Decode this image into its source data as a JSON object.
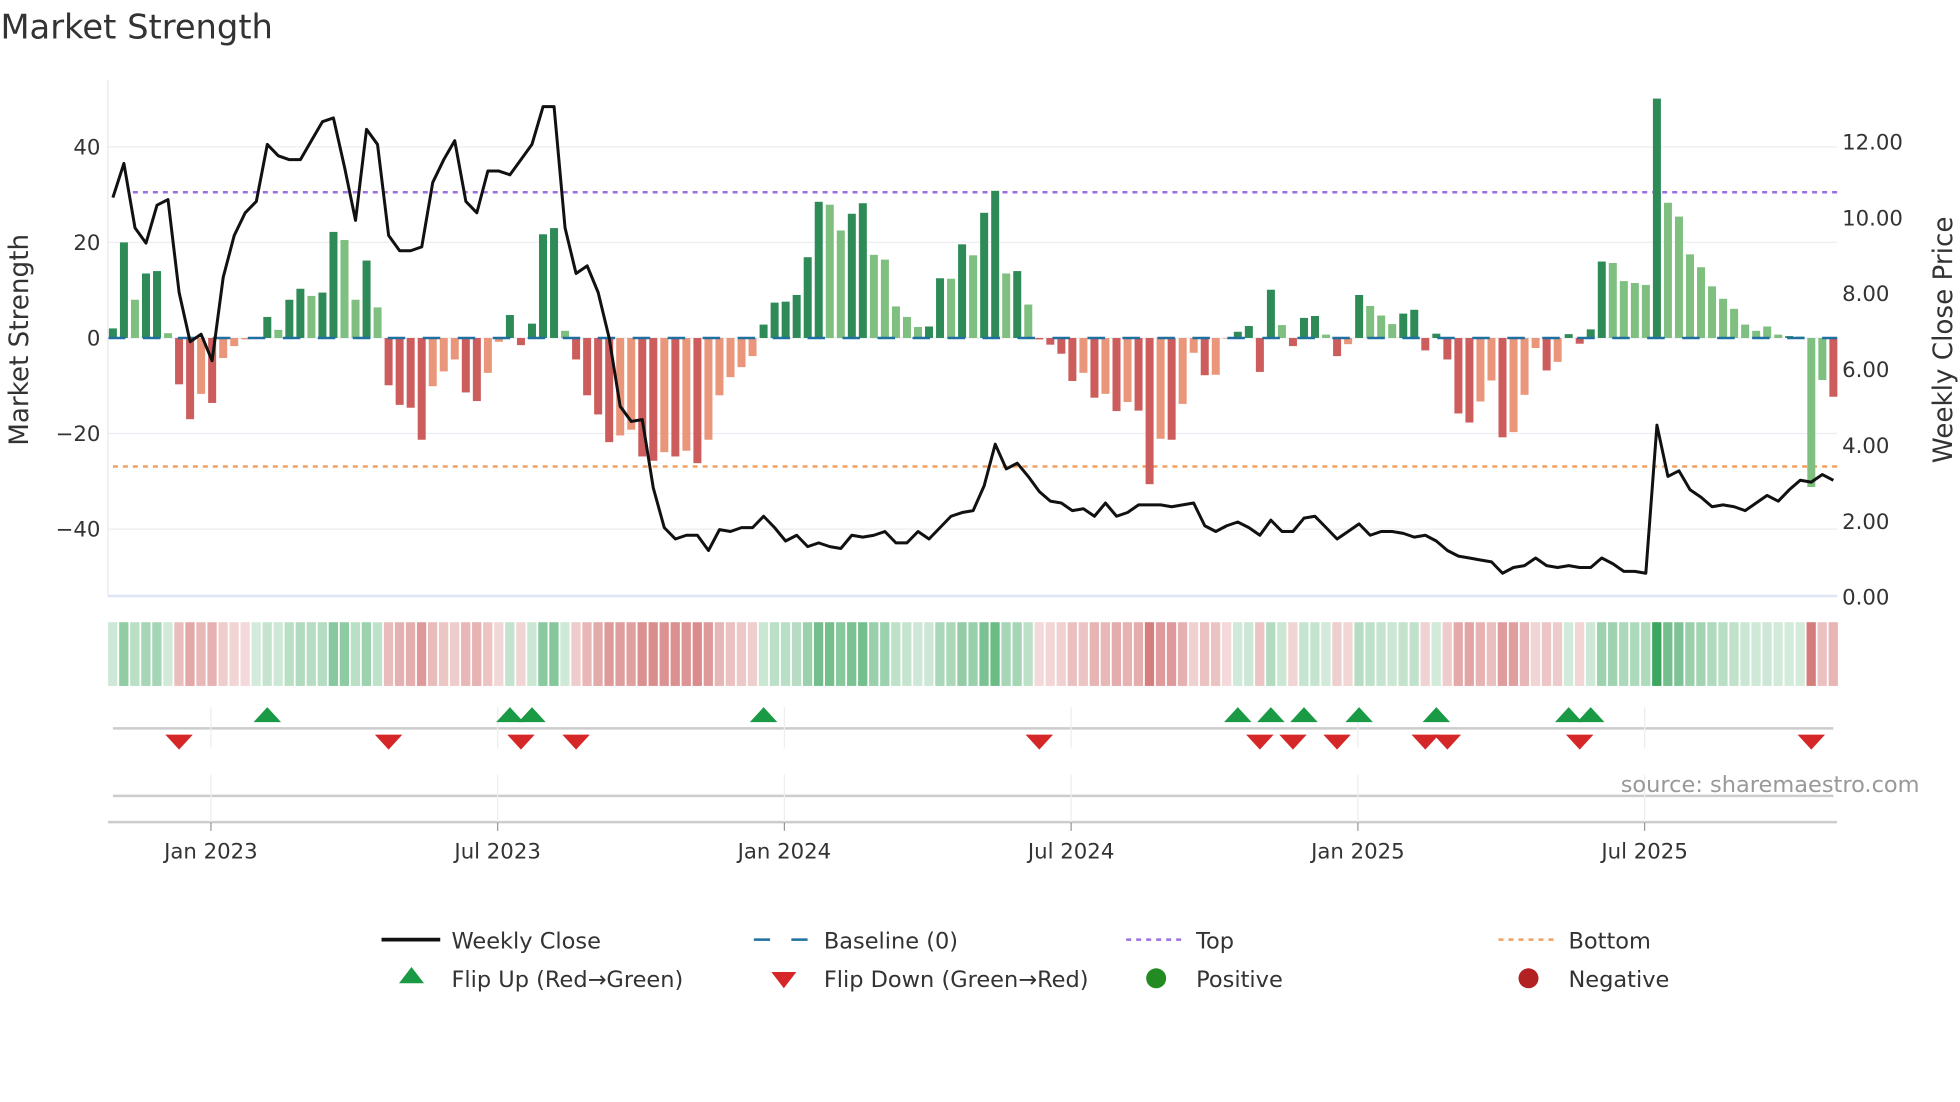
{
  "chart_data": {
    "type": "bar",
    "title": "Market Strength",
    "ylabel": "Market Strength",
    "y2label": "Weekly Close Price",
    "ylim": [
      -54,
      54
    ],
    "y2lim": [
      0,
      13.6
    ],
    "yticks": [
      "40",
      "20",
      "0",
      "−20",
      "−40"
    ],
    "ytick_values": [
      40,
      20,
      0,
      -20,
      -40
    ],
    "y2ticks": [
      "12.00",
      "10.00",
      "8.00",
      "6.00",
      "4.00",
      "2.00",
      "0.00"
    ],
    "y2tick_values": [
      12,
      10,
      8,
      6,
      4,
      2,
      0
    ],
    "xticks": [
      "Jan 2023",
      "Jul 2023",
      "Jan 2024",
      "Jul 2024",
      "Jan 2025",
      "Jul 2025"
    ],
    "xtick_week_index": [
      9,
      35,
      61,
      87,
      113,
      139
    ],
    "top_level": 30.5,
    "bottom_level": -26.9,
    "baseline": 0,
    "strength": [
      2,
      20,
      8,
      13.5,
      14,
      1,
      -9.7,
      -17,
      -11.7,
      -13.6,
      -4.2,
      -1.7,
      -0.3,
      0,
      4.4,
      1.7,
      8,
      10.3,
      8.8,
      9.5,
      22.2,
      20.5,
      8,
      16.2,
      6.4,
      -9.9,
      -14,
      -14.6,
      -21.3,
      -10.1,
      -7,
      -4.5,
      -11.4,
      -13.2,
      -7.3,
      -0.8,
      4.8,
      -1.5,
      3,
      21.7,
      23,
      1.5,
      -4.5,
      -12,
      -16,
      -21.8,
      -20.4,
      -19.2,
      -24.8,
      -25.7,
      -23.9,
      -24.8,
      -23.6,
      -26.2,
      -21.3,
      -12,
      -8.2,
      -6.1,
      -3.8,
      2.8,
      7.4,
      7.6,
      9,
      16.9,
      28.5,
      27.9,
      22.5,
      26,
      28.2,
      17.4,
      16.4,
      6.6,
      4.4,
      2.3,
      2.4,
      12.5,
      12.4,
      19.6,
      17.3,
      26.2,
      30.8,
      13.5,
      14,
      7,
      -0.3,
      -1.4,
      -3.3,
      -9,
      -7.3,
      -12.5,
      -11.7,
      -15.3,
      -13.4,
      -15.2,
      -30.6,
      -21.1,
      -21.3,
      -13.8,
      -3.1,
      -7.8,
      -7.7,
      -0.1,
      1.3,
      2.5,
      -7.1,
      10.1,
      2.7,
      -1.7,
      4.2,
      4.6,
      0.7,
      -3.8,
      -1.3,
      9,
      6.7,
      4.7,
      2.9,
      5.1,
      5.9,
      -2.6,
      0.9,
      -4.5,
      -15.8,
      -17.7,
      -13.3,
      -8.9,
      -20.8,
      -19.7,
      -11.9,
      -2.1,
      -6.8,
      -5,
      0.8,
      -1.2,
      1.8,
      16,
      15.7,
      11.9,
      11.5,
      11.1,
      50.1,
      28.3,
      25.4,
      17.5,
      14.8,
      10.8,
      8.2,
      6.1,
      2.8,
      1.5,
      2.4,
      0.7,
      0.4,
      0.3,
      -31.2,
      -8.8,
      -12.3
    ],
    "strength_shade": "GGgGGgRRrRrrrrGgGGgGGggGgRRRRrrrRRrrGRGGGgRRRRrrRRrRrRrrrrrGGGGGGggGGgggggGGgGgGGgGgRRRRrRrRrRRrRrrRrrGGRGgRGGgRrGgggGGRGRRRrrRrrrRrGRGGggggGgggggggggggGgggRrR",
    "weekly_close": [
      10.5,
      11.4,
      9.7,
      9.3,
      10.3,
      10.45,
      8.0,
      6.7,
      6.9,
      6.2,
      8.4,
      9.5,
      10.1,
      10.4,
      11.9,
      11.6,
      11.5,
      11.5,
      12.0,
      12.5,
      12.6,
      11.3,
      9.9,
      12.3,
      11.9,
      9.5,
      9.1,
      9.1,
      9.2,
      10.9,
      11.5,
      12.0,
      10.4,
      10.1,
      11.2,
      11.2,
      11.1,
      11.5,
      11.9,
      12.9,
      12.9,
      9.7,
      8.5,
      8.7,
      8.0,
      6.8,
      5.0,
      4.6,
      4.65,
      2.85,
      1.8,
      1.5,
      1.6,
      1.6,
      1.2,
      1.75,
      1.7,
      1.8,
      1.8,
      2.1,
      1.8,
      1.45,
      1.6,
      1.3,
      1.4,
      1.3,
      1.25,
      1.6,
      1.55,
      1.6,
      1.7,
      1.4,
      1.4,
      1.7,
      1.5,
      1.8,
      2.1,
      2.2,
      2.25,
      2.9,
      4.0,
      3.35,
      3.5,
      3.15,
      2.75,
      2.5,
      2.45,
      2.25,
      2.3,
      2.1,
      2.45,
      2.1,
      2.2,
      2.4,
      2.4,
      2.4,
      2.35,
      2.4,
      2.45,
      1.85,
      1.7,
      1.85,
      1.95,
      1.8,
      1.6,
      2.0,
      1.7,
      1.7,
      2.05,
      2.1,
      1.8,
      1.5,
      1.7,
      1.9,
      1.6,
      1.7,
      1.7,
      1.65,
      1.55,
      1.6,
      1.45,
      1.2,
      1.05,
      1.0,
      0.95,
      0.9,
      0.6,
      0.75,
      0.8,
      1.0,
      0.8,
      0.75,
      0.8,
      0.75,
      0.75,
      1.0,
      0.85,
      0.65,
      0.65,
      0.6,
      4.5,
      3.15,
      3.3,
      2.8,
      2.6,
      2.35,
      2.4,
      2.35,
      2.25,
      2.45,
      2.65,
      2.5,
      2.8,
      3.05,
      3.0,
      3.2,
      3.05
    ],
    "flip_up_week_index": [
      14,
      36,
      38,
      59,
      102,
      105,
      108,
      113,
      120,
      132,
      134
    ],
    "flip_down_week_index": [
      6,
      25,
      37,
      42,
      84,
      104,
      107,
      111,
      119,
      121,
      133,
      154
    ],
    "legend": {
      "weekly_close": "Weekly Close",
      "baseline": "Baseline (0)",
      "top": "Top",
      "bottom": "Bottom",
      "flip_up": "Flip Up (Red→Green)",
      "flip_down": "Flip Down (Green→Red)",
      "positive": "Positive",
      "negative": "Negative"
    },
    "legend_placement": "bottom",
    "source": "source: sharemaestro.com"
  },
  "colors": {
    "strong_green": "#2e8b57",
    "light_green": "#7fbf7f",
    "strong_red": "#cd5c5c",
    "light_red": "#e9967a",
    "top": "#9b6fe0",
    "bottom": "#f0a060",
    "baseline": "#1f6fa0",
    "flip_up": "#1a9a45",
    "flip_down": "#d62728",
    "positive": "#228b22",
    "negative": "#b22222"
  }
}
